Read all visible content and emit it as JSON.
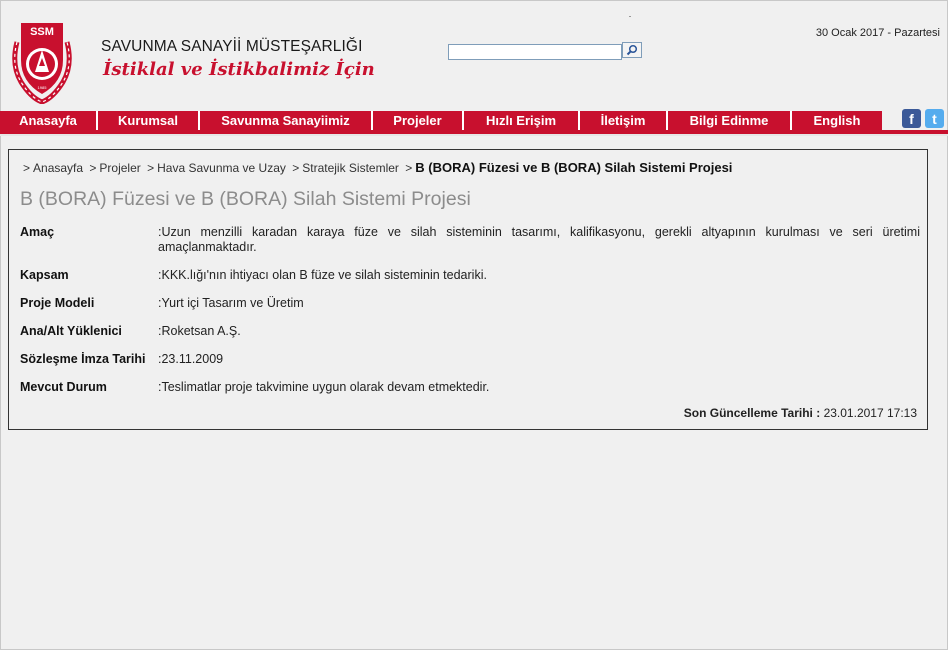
{
  "header": {
    "org_name": "SAVUNMA SANAYİİ MÜSTEŞARLIĞI",
    "slogan": "İstiklal ve İstikbalimiz İçin",
    "logo_text": "SSM",
    "logo_year": "1985",
    "date": "30 Ocak 2017 - Pazartesi",
    "search": {
      "value": "",
      "placeholder": ""
    }
  },
  "nav": {
    "items": [
      {
        "label": "Anasayfa"
      },
      {
        "label": "Kurumsal"
      },
      {
        "label": "Savunma Sanayiimiz"
      },
      {
        "label": "Projeler"
      },
      {
        "label": "Hızlı Erişim"
      },
      {
        "label": "İletişim"
      },
      {
        "label": "Bilgi Edinme"
      },
      {
        "label": "English"
      }
    ]
  },
  "social": {
    "facebook": "f",
    "twitter": "t"
  },
  "breadcrumb": {
    "items": [
      "Anasayfa",
      "Projeler",
      "Hava Savunma ve Uzay",
      "Stratejik Sistemler"
    ],
    "current": "B (BORA) Füzesi ve B (BORA) Silah Sistemi Projesi",
    "separator": ">"
  },
  "page": {
    "title": "B (BORA) Füzesi ve B (BORA) Silah Sistemi Projesi",
    "fields": [
      {
        "label": "Amaç",
        "value": "Uzun menzilli karadan karaya füze ve silah sisteminin tasarımı, kalifikasyonu, gerekli altyapının kurulması ve seri üretimi amaçlanmaktadır."
      },
      {
        "label": "Kapsam",
        "value": "KKK.lığı'nın ihtiyacı olan B füze ve silah sisteminin tedariki."
      },
      {
        "label": "Proje Modeli",
        "value": "Yurt içi Tasarım ve Üretim"
      },
      {
        "label": "Ana/Alt Yüklenici",
        "value": "Roketsan A.Ş."
      },
      {
        "label": "Sözleşme İmza Tarihi",
        "value": "23.11.2009"
      },
      {
        "label": "Mevcut Durum",
        "value": "Teslimatlar proje takvimine uygun olarak devam etmektedir."
      }
    ],
    "updated_label": "Son Güncelleme Tarihi :",
    "updated_value": "23.01.2017 17:13"
  },
  "colors": {
    "brand_red": "#c8102e",
    "title_gray": "#8c8c8c"
  }
}
